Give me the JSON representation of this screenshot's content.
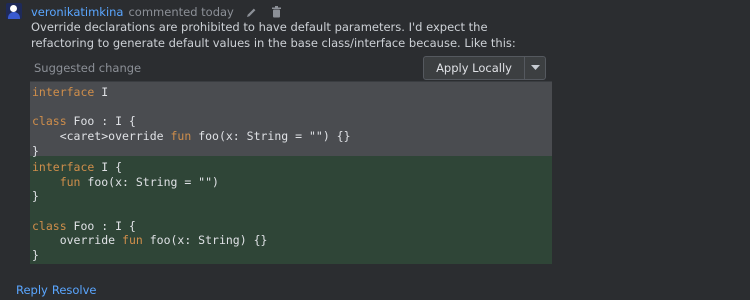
{
  "comment": {
    "author": "veronikatimkina",
    "meta": "commented today",
    "body": "Override declarations are prohibited to have default parameters. I'd expect the refactoring to generate default values in the base class/interface because. Like this:"
  },
  "suggestion": {
    "title": "Suggested change",
    "apply_label": "Apply Locally",
    "old_lines": [
      [
        {
          "t": "interface",
          "k": true
        },
        {
          "t": " I"
        }
      ],
      [],
      [
        {
          "t": "class",
          "k": true
        },
        {
          "t": " Foo : I {"
        }
      ],
      [
        {
          "t": "    <caret>override "
        },
        {
          "t": "fun",
          "k": true
        },
        {
          "t": " foo(x: String = \"\") {}"
        }
      ],
      [
        {
          "t": "}"
        }
      ]
    ],
    "new_lines": [
      [
        {
          "t": "interface",
          "k": true
        },
        {
          "t": " I {"
        }
      ],
      [
        {
          "t": "    "
        },
        {
          "t": "fun",
          "k": true
        },
        {
          "t": " foo(x: String = \"\")"
        }
      ],
      [
        {
          "t": "}"
        }
      ],
      [],
      [
        {
          "t": "class",
          "k": true
        },
        {
          "t": " Foo : I {"
        }
      ],
      [
        {
          "t": "    override "
        },
        {
          "t": "fun",
          "k": true
        },
        {
          "t": " foo(x: String) {}"
        }
      ],
      [
        {
          "t": "}"
        }
      ]
    ]
  },
  "footer": {
    "reply_label": "Reply",
    "resolve_label": "Resolve"
  },
  "icons": {
    "edit": "pencil-icon",
    "delete": "trash-icon",
    "dropdown": "chevron-down-icon"
  },
  "colors": {
    "link": "#5aa6ff",
    "keyword": "#cf8e4b",
    "removed_bg": "#4a4c50",
    "added_bg": "#2f4537"
  }
}
